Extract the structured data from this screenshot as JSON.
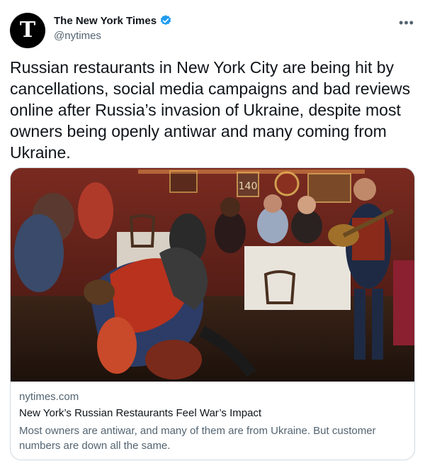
{
  "author": {
    "display_name": "The New York Times",
    "handle": "@nytimes",
    "avatar_letter": "T",
    "verified_color": "#1d9bf0"
  },
  "more_icon": "more-dots-icon",
  "tweet": {
    "text": "Russian restaurants in New York City are being hit by cancellations, social media campaigns and bad reviews online after Russia’s invasion of Ukraine, despite most owners being openly antiwar and many coming from Ukraine."
  },
  "card": {
    "image_sign": "140",
    "domain": "nytimes.com",
    "title": "New York’s Russian Restaurants Feel War’s Impact",
    "description": "Most owners are antiwar, and many of them are from Ukraine. But customer numbers are down all the same."
  }
}
